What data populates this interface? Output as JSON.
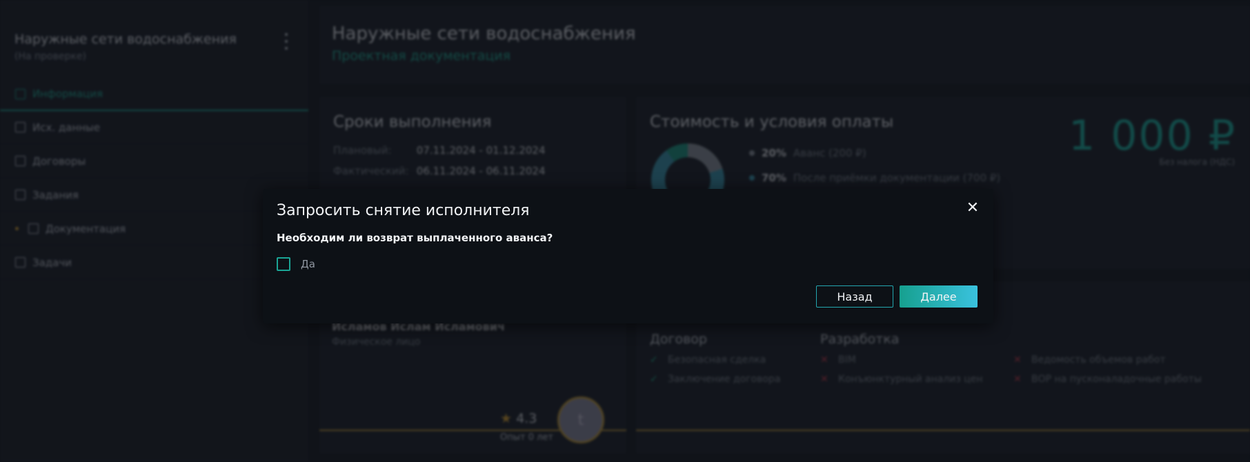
{
  "sidebar": {
    "title": "Наружные сети водоснабжения",
    "status": "(На проверке)",
    "items": [
      {
        "label": "Информация"
      },
      {
        "label": "Исх. данные"
      },
      {
        "label": "Договоры"
      },
      {
        "label": "Задания"
      },
      {
        "label": "Документация"
      },
      {
        "label": "Задачи"
      }
    ]
  },
  "header": {
    "title": "Наружные сети водоснабжения",
    "subtitle": "Проектная документация"
  },
  "deadlines": {
    "title": "Сроки выполнения",
    "planned_label": "Плановый:",
    "planned_value": "07.11.2024 - 01.12.2024",
    "actual_label": "Фактический:",
    "actual_value": "06.11.2024 - 06.11.2024"
  },
  "payment": {
    "title": "Стоимость и условия оплаты",
    "price": "1 000 ₽",
    "price_note": "Без налога (НДС)",
    "legend": [
      {
        "pct": "20%",
        "text": "Аванс (200 ₽)",
        "color": "#8e96a0"
      },
      {
        "pct": "70%",
        "text": "После приёмки документации (700 ₽)",
        "color": "#3a9bb4"
      }
    ]
  },
  "executor": {
    "name": "Исламов Ислам Исламович",
    "type": "Физическое лицо",
    "rating": "4.3",
    "experience": "Опыт 0 лет",
    "avatar_letter": "t"
  },
  "conditions": {
    "contract_title": "Договор",
    "contract_items": [
      "Безопасная сделка",
      "Заключение договора"
    ],
    "dev_title": "Разработка",
    "dev_items": [
      "BIM",
      "Конъюнктурный анализ цен"
    ],
    "extra_items": [
      "Ведомость объемов работ",
      "ВОР на пусконаладочные работы"
    ]
  },
  "modal": {
    "title": "Запросить снятие исполнителя",
    "question": "Необходим ли возврат выплаченного аванса?",
    "checkbox_label": "Да",
    "back_label": "Назад",
    "next_label": "Далее",
    "accent": "#1aa595"
  }
}
